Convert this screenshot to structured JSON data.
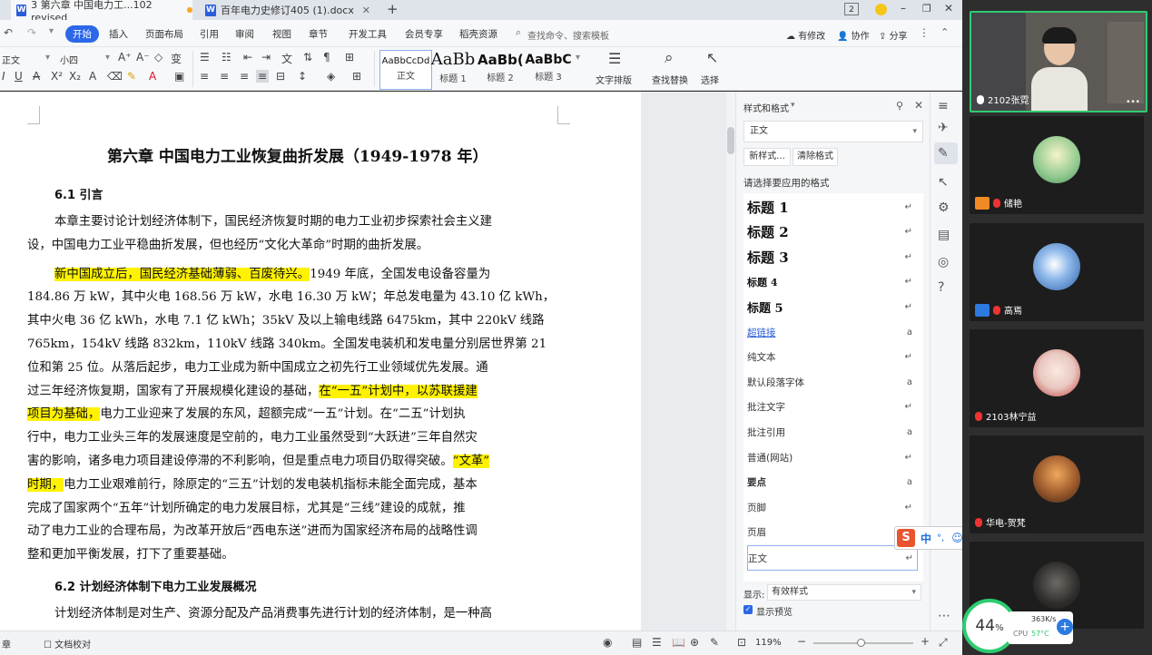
{
  "tabs": [
    {
      "label": "3 第六章 中国电力工...102 revised",
      "active": true
    },
    {
      "label": "百年电力史修订405 (1).docx",
      "active": false
    }
  ],
  "window": {
    "page_badge": "2",
    "new_tab": "+"
  },
  "menu": [
    "开始",
    "插入",
    "页面布局",
    "引用",
    "审阅",
    "视图",
    "章节",
    "开发工具",
    "会员专享",
    "稻壳资源"
  ],
  "search_placeholder": "查找命令、搜索模板",
  "menu_right": {
    "modify": "有修改",
    "collab": "协作",
    "share": "分享"
  },
  "toolbar": {
    "font_name": "正文",
    "font_size": "小四",
    "styles": [
      {
        "preview": "AaBbCcDd",
        "label": "正文"
      },
      {
        "preview": "AaBb",
        "label": "标题 1"
      },
      {
        "preview": "AaBb(",
        "label": "标题 2"
      },
      {
        "preview": "AaBbC",
        "label": "标题 3"
      }
    ],
    "text_layout": "文字排版",
    "find_replace": "查找替换",
    "select": "选择"
  },
  "document": {
    "title": "第六章  中国电力工业恢复曲折发展（1949-1978 年）",
    "h1": "6.1 引言",
    "lines": [
      {
        "indent": true,
        "parts": [
          {
            "t": "本章主要讨论计划经济体制下，国民经济恢复时期的电力工业初步探索社会主义建",
            "hl": false
          }
        ]
      },
      {
        "indent": false,
        "parts": [
          {
            "t": "设，中国电力工业平稳曲折发展，但也经历“文化大革命”时期的曲折发展。",
            "hl": false
          }
        ]
      },
      {
        "indent": true,
        "parts": [
          {
            "t": "新中国成立后，国民经济基础薄弱、百废待兴。",
            "hl": true
          },
          {
            "t": "1949 年底，全国发电设备容量为",
            "hl": false
          }
        ]
      },
      {
        "indent": false,
        "parts": [
          {
            "t": "184.86 万 kW，其中火电 168.56 万 kW，水电 16.30 万 kW；年总发电量为 43.10 亿 kWh，",
            "hl": false
          }
        ]
      },
      {
        "indent": false,
        "parts": [
          {
            "t": "其中火电 36 亿 kWh，水电 7.1 亿 kWh；35kV 及以上输电线路 6475km，其中 220kV 线路",
            "hl": false
          }
        ]
      },
      {
        "indent": false,
        "parts": [
          {
            "t": "765km，154kV 线路 832km，110kV 线路 340km。全国发电装机和发电量分别居世界第 21",
            "hl": false
          }
        ]
      },
      {
        "indent": false,
        "parts": [
          {
            "t": "位和第 25 位。从落后起步，电力工业成为新中国成立之初先行工业领域优先发展。通",
            "hl": false
          }
        ]
      },
      {
        "indent": false,
        "parts": [
          {
            "t": "过三年经济恢复期，国家有了开展规模化建设的基础，",
            "hl": false
          },
          {
            "t": "在“一五”计划中，以苏联援建",
            "hl": true
          }
        ]
      },
      {
        "indent": false,
        "parts": [
          {
            "t": "项目为基础，",
            "hl": true
          },
          {
            "t": "电力工业迎来了发展的东风，超额完成“一五”计划。在“二五”计划执",
            "hl": false
          }
        ]
      },
      {
        "indent": false,
        "parts": [
          {
            "t": "行中，电力工业头三年的发展速度是空前的，电力工业虽然受到“大跃进”三年自然灾",
            "hl": false
          }
        ]
      },
      {
        "indent": false,
        "parts": [
          {
            "t": "害的影响，诸多电力项目建设停滞的不利影响，但是重点电力项目仍取得突破。",
            "hl": false
          },
          {
            "t": "“文革”",
            "hl": true
          }
        ]
      },
      {
        "indent": false,
        "parts": [
          {
            "t": "时期，",
            "hl": true
          },
          {
            "t": "电力工业艰难前行，除原定的“三五”计划的发电装机指标未能全面完成，基本",
            "hl": false
          }
        ]
      },
      {
        "indent": false,
        "parts": [
          {
            "t": "完成了国家两个“五年”计划所确定的电力发展目标，尤其是“三线”建设的成就，推",
            "hl": false
          }
        ]
      },
      {
        "indent": false,
        "parts": [
          {
            "t": "动了电力工业的合理布局，为改革开放后“西电东送”进而为国家经济布局的战略性调",
            "hl": false
          }
        ]
      },
      {
        "indent": false,
        "parts": [
          {
            "t": "整和更加平衡发展，打下了重要基础。",
            "hl": false
          }
        ]
      }
    ],
    "h2": "6.2 计划经济体制下电力工业发展概况",
    "last_line": "计划经济体制是对生产、资源分配及产品消费事先进行计划的经济体制，是一种高"
  },
  "styles_panel": {
    "title": "样式和格式",
    "current": "正文",
    "new_style": "新样式...",
    "clear_format": "清除格式",
    "prompt": "请选择要应用的格式",
    "items": [
      "标题  1",
      "标题  2",
      "标题  3",
      "标题 4",
      "标题  5",
      "超链接",
      "纯文本",
      "默认段落字体",
      "批注文字",
      "批注引用",
      "普通(网站)",
      "要点",
      "页脚",
      "页眉",
      "正文"
    ],
    "show_label": "显示:",
    "show_value": "有效样式",
    "preview_label": "显示预览"
  },
  "status": {
    "left1": "章",
    "left2": "文档校对",
    "zoom": "119%"
  },
  "ime": {
    "mode": "中",
    "punct": "°,"
  },
  "participants": [
    {
      "name": "2102张霓"
    },
    {
      "name": "储艳"
    },
    {
      "name": "高焉"
    },
    {
      "name": "2103林宁益"
    },
    {
      "name": "华电-贺梵"
    }
  ],
  "perf": {
    "percent": "44",
    "unit": "%",
    "net": "363K/s",
    "cpu_label": "CPU",
    "cpu_temp": "57°C"
  },
  "colors": {
    "accent": "#2b67e8",
    "highlight": "#fff200",
    "active_speaker": "#2ecc71"
  }
}
